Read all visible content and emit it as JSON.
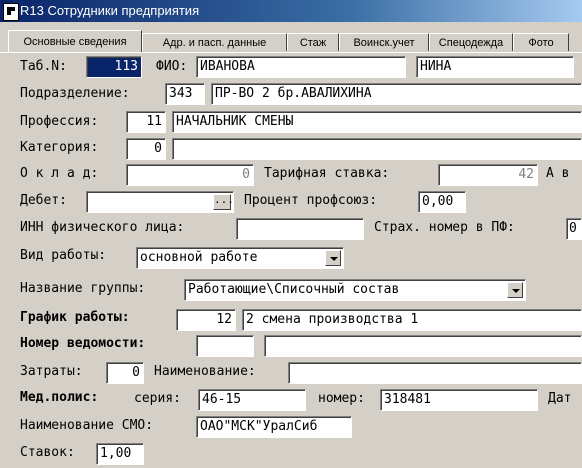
{
  "window": {
    "title": "R13 Сотрудники предприятия"
  },
  "tabs": [
    {
      "label": "Основные сведения"
    },
    {
      "label": "Адр. и пасп. данные"
    },
    {
      "label": "Стаж"
    },
    {
      "label": "Воинск.учет"
    },
    {
      "label": "Спецодежда"
    },
    {
      "label": "Фото"
    }
  ],
  "form": {
    "tab_no": {
      "label": "Таб.N:",
      "value": "113"
    },
    "fio": {
      "label": "ФИО:",
      "last_name": "ИВАНОВА",
      "first_name": "НИНА"
    },
    "department": {
      "label": "Подразделение:",
      "code": "343",
      "name": "ПР-ВО 2  бр.АВАЛИХИНА"
    },
    "profession": {
      "label": "Профессия:",
      "code": "11",
      "name": "НАЧАЛЬНИК СМЕНЫ"
    },
    "category": {
      "label": "Категория:",
      "code": "0",
      "name": ""
    },
    "salary": {
      "label": "О к л а д:",
      "value": "0"
    },
    "tariff": {
      "label": "Тарифная  ставка:",
      "value": "42"
    },
    "av_label": "А в",
    "debit": {
      "label": "Дебет:",
      "value": "",
      "button": "..."
    },
    "union_percent": {
      "label": "Процент профсоюз:",
      "value": "0,00"
    },
    "inn": {
      "label": "ИНН физического лица:",
      "value": ""
    },
    "insurance": {
      "label": "Страх. номер  в ПФ:",
      "value": "0"
    },
    "work_type": {
      "label": "Вид работы:",
      "value": "основной работе"
    },
    "group_name": {
      "label": "Название группы:",
      "value": "Работающие\\Списочный состав"
    },
    "schedule": {
      "label": "График работы:",
      "code": "12",
      "name": "2 смена производства 1"
    },
    "statement": {
      "label": "Номер ведомости:",
      "code": "",
      "name": ""
    },
    "expenses": {
      "label": "Затраты:",
      "value": "0"
    },
    "expense_name": {
      "label": "Наименование:",
      "value": ""
    },
    "med_policy": {
      "label": "Мед.полис:",
      "series_label": "серия:",
      "series": "46-15",
      "number_label": "номер:",
      "number": "318481",
      "date_label": "Дат"
    },
    "smo": {
      "label": "Наименование СМО:",
      "value": "ОАО\"МСК\"УралСиб"
    },
    "rates": {
      "label": "Ставок:",
      "value": "1,00"
    }
  }
}
